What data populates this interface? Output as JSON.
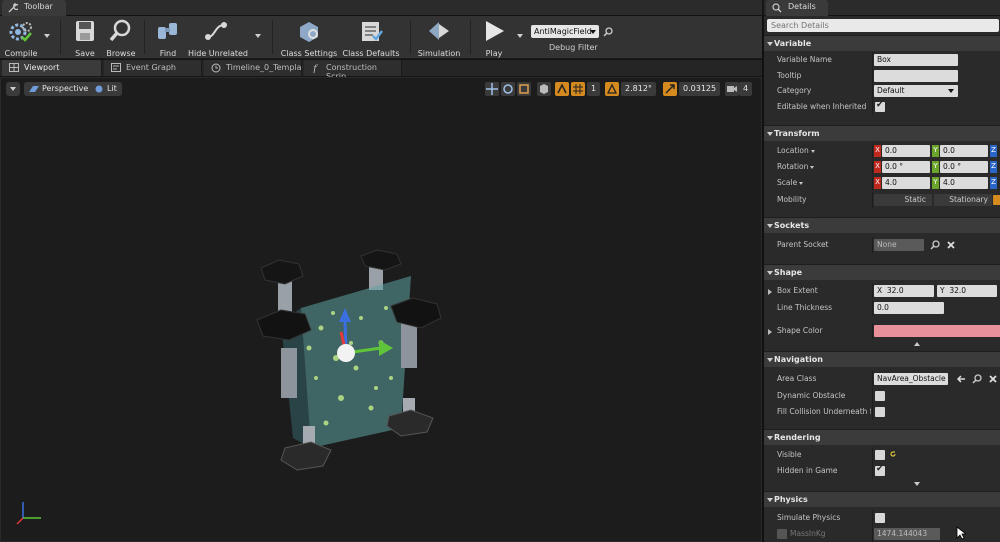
{
  "tabs": {
    "toolbar": "Toolbar",
    "details": "Details"
  },
  "toolbar": {
    "buttons": [
      "Compile",
      "Save",
      "Browse",
      "Find",
      "Hide Unrelated",
      "Class Settings",
      "Class Defaults",
      "Simulation",
      "Play"
    ],
    "debug_object": "AntiMagicField",
    "debug_filter_label": "Debug Filter"
  },
  "doc_tabs": [
    "Viewport",
    "Event Graph",
    "Timeline_0_Templa",
    "Construction Scrip"
  ],
  "viewport": {
    "perspective": "Perspective",
    "lit": "Lit",
    "rotation_snap": "2.812°",
    "scale_snap": "0.03125",
    "camera_speed": "4"
  },
  "details": {
    "search_placeholder": "Search Details",
    "variable": {
      "title": "Variable",
      "name_label": "Variable Name",
      "name_value": "Box",
      "tooltip_label": "Tooltip",
      "tooltip_value": "",
      "category_label": "Category",
      "category_value": "Default",
      "editable_label": "Editable when Inherited",
      "editable_checked": true
    },
    "transform": {
      "title": "Transform",
      "location_label": "Location",
      "location": [
        "0.0",
        "0.0"
      ],
      "rotation_label": "Rotation",
      "rotation": [
        "0.0 °",
        "0.0 °"
      ],
      "scale_label": "Scale",
      "scale": [
        "4.0",
        "4.0"
      ],
      "mobility_label": "Mobility",
      "mobility_static": "Static",
      "mobility_stationary": "Stationary"
    },
    "sockets": {
      "title": "Sockets",
      "parent_label": "Parent Socket",
      "parent_value": "None"
    },
    "shape": {
      "title": "Shape",
      "extent_label": "Box Extent",
      "extent_x": "32.0",
      "extent_y": "32.0",
      "thickness_label": "Line Thickness",
      "thickness_value": "0.0",
      "color_label": "Shape Color",
      "color_hex": "#e8919b"
    },
    "navigation": {
      "title": "Navigation",
      "area_label": "Area Class",
      "area_value": "NavArea_Obstacle",
      "dynamic_label": "Dynamic Obstacle",
      "fill_label": "Fill Collision Underneath for N"
    },
    "rendering": {
      "title": "Rendering",
      "visible_label": "Visible",
      "visible_checked": false,
      "hidden_label": "Hidden in Game",
      "hidden_checked": true
    },
    "physics": {
      "title": "Physics",
      "simulate_label": "Simulate Physics",
      "mass_label": "MassInKg",
      "mass_value": "1474.144043"
    }
  },
  "colors": {
    "accent_orange": "#d58a1f",
    "panel_bg": "#2a2a2a",
    "viewport_bg": "#1c1c1c",
    "field_blue": "#5b8ad6"
  }
}
